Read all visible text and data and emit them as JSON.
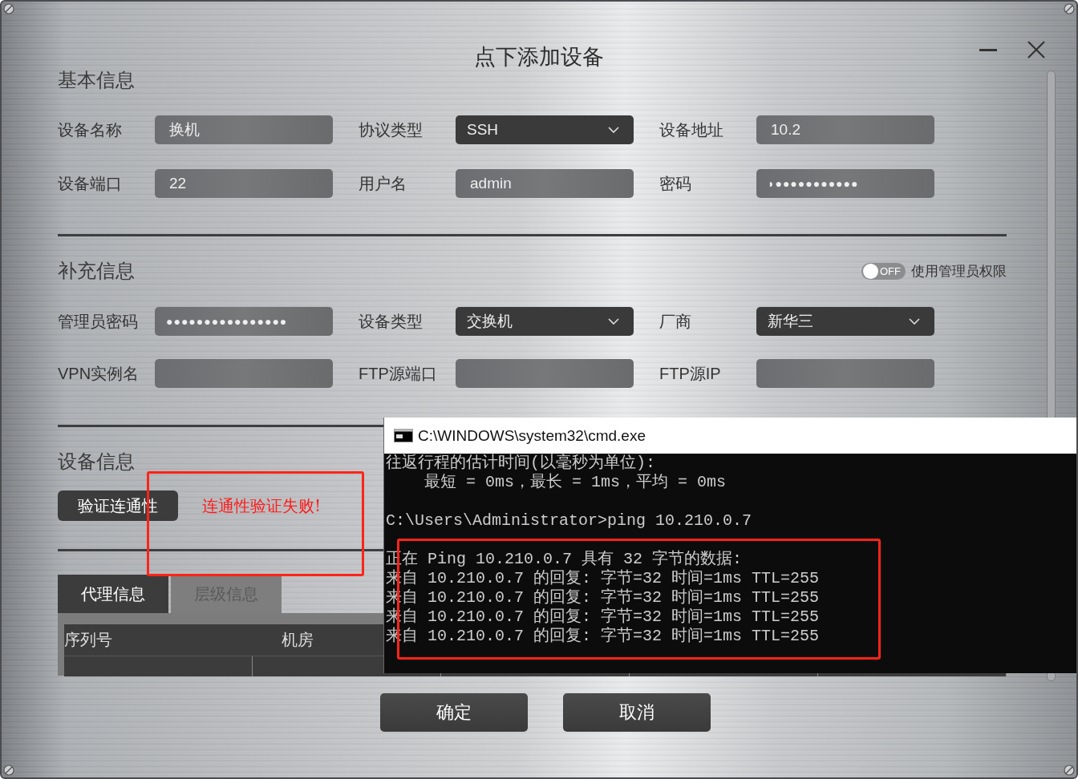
{
  "window": {
    "title": "点下添加设备"
  },
  "basic": {
    "title": "基本信息",
    "fields": [
      {
        "label": "设备名称",
        "kind": "text",
        "value": "换机"
      },
      {
        "label": "协议类型",
        "kind": "select",
        "value": "SSH"
      },
      {
        "label": "设备地址",
        "kind": "text",
        "value": "10.2"
      },
      {
        "label": "设备端口",
        "kind": "text",
        "value": "22"
      },
      {
        "label": "用户名",
        "kind": "text",
        "value": "admin"
      },
      {
        "label": "密码",
        "kind": "password",
        "value": "◗●●●●●●●●●●●"
      }
    ]
  },
  "extra": {
    "title": "补充信息",
    "toggle": {
      "label": "使用管理员权限",
      "on": false,
      "state_text": "OFF"
    },
    "fields": [
      {
        "label": "管理员密码",
        "kind": "password",
        "value": "●●●●●●●●●●●●●●●●"
      },
      {
        "label": "设备类型",
        "kind": "select",
        "value": "交换机"
      },
      {
        "label": "厂商",
        "kind": "select",
        "value": "新华三"
      },
      {
        "label": "VPN实例名",
        "kind": "text"
      },
      {
        "label": "FTP源端口",
        "kind": "text"
      },
      {
        "label": "FTP源IP",
        "kind": "text"
      }
    ]
  },
  "device": {
    "title": "设备信息",
    "verify_button": "验证连通性",
    "status": "连通性验证失败!",
    "tabs": [
      {
        "label": "代理信息",
        "selected": true
      },
      {
        "label": "层级信息",
        "selected": false
      }
    ],
    "table": {
      "columns": [
        "序列号",
        "机房"
      ]
    }
  },
  "buttons": [
    "确定",
    "取消"
  ],
  "cmd": {
    "title": "C:\\WINDOWS\\system32\\cmd.exe",
    "blocks": [
      [
        "往返行程的估计时间(以毫秒为单位):",
        "    最短 = 0ms，最长 = 1ms，平均 = 0ms"
      ],
      [
        "C:\\Users\\Administrator>ping 10.210.0.7"
      ],
      [
        "正在 Ping 10.210.0.7 具有 32 字节的数据:",
        "来自 10.210.0.7 的回复: 字节=32 时间=1ms TTL=255",
        "来自 10.210.0.7 的回复: 字节=32 时间=1ms TTL=255",
        "来自 10.210.0.7 的回复: 字节=32 时间=1ms TTL=255",
        "来自 10.210.0.7 的回复: 字节=32 时间=1ms TTL=255"
      ]
    ]
  }
}
